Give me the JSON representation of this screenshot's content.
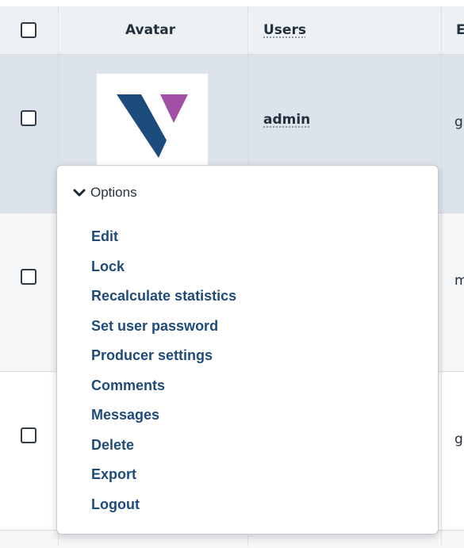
{
  "table": {
    "headers": {
      "avatar": "Avatar",
      "users": "Users",
      "clipped_col": "E"
    },
    "rows": [
      {
        "user": "admin",
        "clipped": "g"
      },
      {
        "user": "",
        "clipped": "m"
      },
      {
        "user": "",
        "clipped": "g"
      }
    ]
  },
  "options_menu": {
    "title": "Options",
    "items": [
      "Edit",
      "Lock",
      "Recalculate statistics",
      "Set user password",
      "Producer settings",
      "Comments",
      "Messages",
      "Delete",
      "Export",
      "Logout"
    ]
  },
  "colors": {
    "link": "#1f4b7a",
    "logo_blue": "#1c4c7c",
    "logo_purple": "#a24fa6"
  },
  "icons": {
    "menu_toggle": "chevron-down-icon",
    "avatar_logo": "v-logo"
  }
}
